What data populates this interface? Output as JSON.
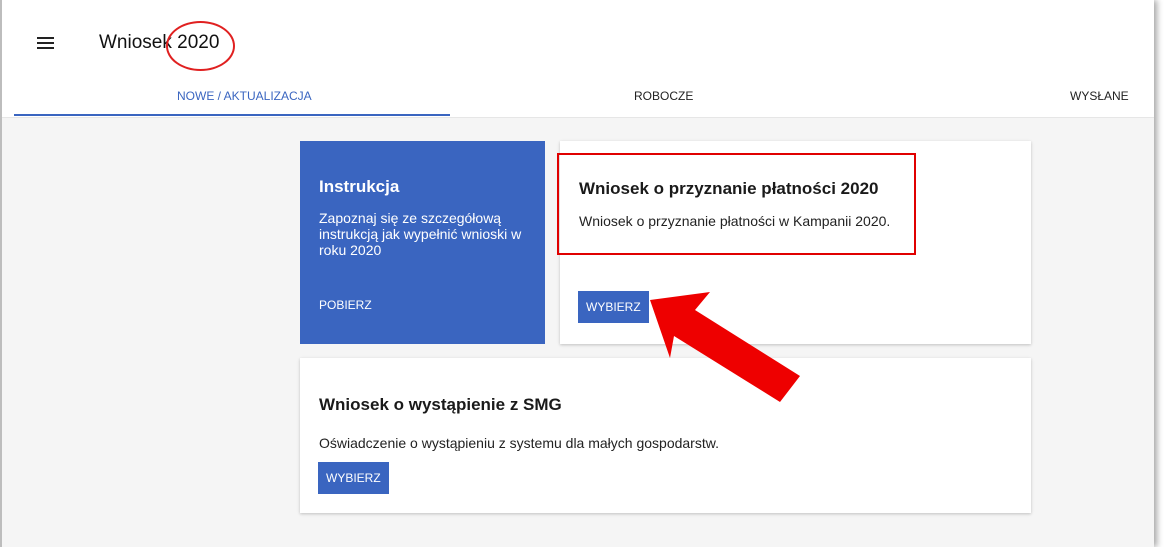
{
  "header": {
    "title": "Wniosek 2020",
    "menu_icon": "hamburger-menu-icon"
  },
  "tabs": [
    {
      "label": "NOWE / AKTUALIZACJA",
      "active": true
    },
    {
      "label": "ROBOCZE",
      "active": false
    },
    {
      "label": "WYSŁANE",
      "active": false
    }
  ],
  "cards": {
    "instruction": {
      "title": "Instrukcja",
      "description": "Zapoznaj się ze szczegółową instrukcją jak wypełnić wnioski w roku 2020",
      "link_label": "POBIERZ"
    },
    "payment": {
      "title": "Wniosek o przyznanie płatności 2020",
      "description": "Wniosek o przyznanie płatności w Kampanii 2020.",
      "button_label": "WYBIERZ"
    },
    "smg": {
      "title": "Wniosek o wystąpienie z SMG",
      "description": "Oświadczenie o wystąpieniu z systemu dla małych gospodarstw.",
      "button_label": "WYBIERZ"
    }
  },
  "colors": {
    "accent": "#3a65c0",
    "annotation": "#e00000",
    "background": "#f5f5f5"
  }
}
